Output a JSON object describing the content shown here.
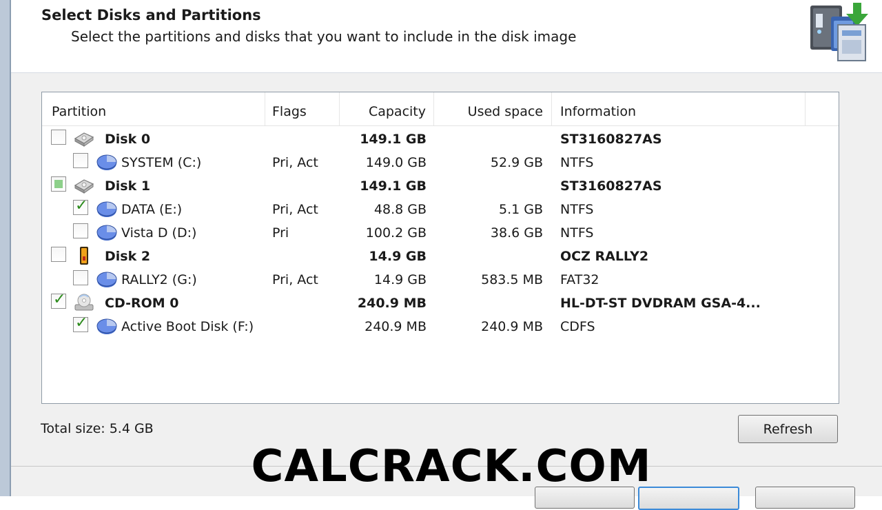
{
  "header": {
    "title": "Select Disks and Partitions",
    "subtitle": "Select the partitions and disks that you want to include in the disk image"
  },
  "columns": [
    "Partition",
    "Flags",
    "Capacity",
    "Used space",
    "Information"
  ],
  "rows": [
    {
      "name": "Disk 0",
      "flags": "",
      "capacity": "149.1 GB",
      "used": "",
      "info": "ST3160827AS",
      "level": 0,
      "bold": true,
      "checked": "unchecked",
      "icon": "hard-disk-icon"
    },
    {
      "name": "SYSTEM (C:)",
      "flags": "Pri, Act",
      "capacity": "149.0 GB",
      "used": "52.9 GB",
      "info": "NTFS",
      "level": 1,
      "bold": false,
      "checked": "unchecked",
      "icon": "partition-icon"
    },
    {
      "name": "Disk 1",
      "flags": "",
      "capacity": "149.1 GB",
      "used": "",
      "info": "ST3160827AS",
      "level": 0,
      "bold": true,
      "checked": "partial",
      "icon": "hard-disk-icon"
    },
    {
      "name": "DATA (E:)",
      "flags": "Pri, Act",
      "capacity": "48.8 GB",
      "used": "5.1 GB",
      "info": "NTFS",
      "level": 1,
      "bold": false,
      "checked": "checked",
      "icon": "partition-icon"
    },
    {
      "name": "Vista D (D:)",
      "flags": "Pri",
      "capacity": "100.2 GB",
      "used": "38.6 GB",
      "info": "NTFS",
      "level": 1,
      "bold": false,
      "checked": "unchecked",
      "icon": "partition-icon"
    },
    {
      "name": "Disk 2",
      "flags": "",
      "capacity": "14.9 GB",
      "used": "",
      "info": "OCZ RALLY2",
      "level": 0,
      "bold": true,
      "checked": "unchecked",
      "icon": "usb-drive-icon"
    },
    {
      "name": "RALLY2 (G:)",
      "flags": "Pri, Act",
      "capacity": "14.9 GB",
      "used": "583.5 MB",
      "info": "FAT32",
      "level": 1,
      "bold": false,
      "checked": "unchecked",
      "icon": "partition-icon"
    },
    {
      "name": "CD-ROM 0",
      "flags": "",
      "capacity": "240.9 MB",
      "used": "",
      "info": "HL-DT-ST DVDRAM GSA-4...",
      "level": 0,
      "bold": true,
      "checked": "checked",
      "icon": "cd-rom-icon"
    },
    {
      "name": "Active Boot Disk (F:)",
      "flags": "",
      "capacity": "240.9 MB",
      "used": "240.9 MB",
      "info": "CDFS",
      "level": 1,
      "bold": false,
      "checked": "checked",
      "icon": "partition-icon"
    }
  ],
  "footer": {
    "total_size": "Total size: 5.4 GB",
    "refresh_label": "Refresh"
  },
  "watermark": "CALCRACK.COM"
}
